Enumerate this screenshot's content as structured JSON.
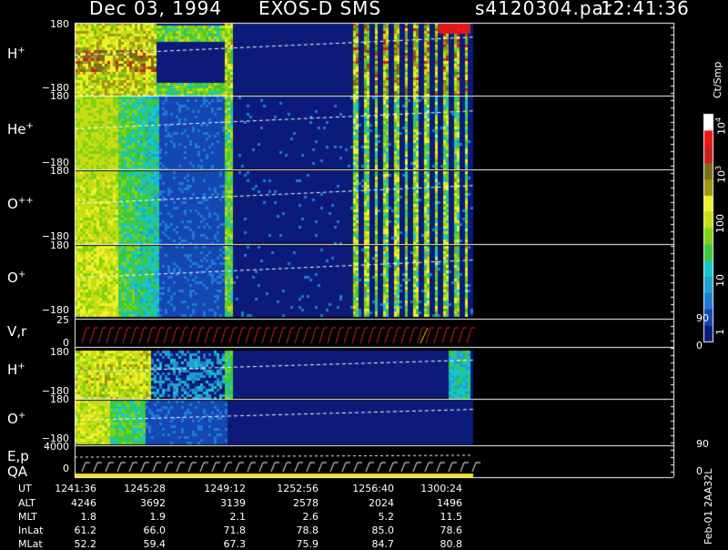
{
  "header": {
    "date": "Dec 03, 1994",
    "instrument": "EXOS-D SMS",
    "file": "s4120304.par",
    "time": "12:41:36"
  },
  "colorbar": {
    "unit": "Ct/Smp",
    "labels": [
      "1",
      "10",
      "100",
      "3",
      "4"
    ],
    "base": "10",
    "colors": [
      "#0c1a7a",
      "#1446b4",
      "#1e7ad2",
      "#1ea0d2",
      "#14c8c8",
      "#3cc83c",
      "#82d214",
      "#c8dc14",
      "#f0f028",
      "#a09614",
      "#786e14",
      "#c81e1e",
      "#f01414",
      "#ffffff"
    ]
  },
  "side_text": "Feb-01 2AA32L",
  "chart_data": {
    "type": "heatmap",
    "time_range": [
      "12:41:36",
      "13:01:42"
    ],
    "panels": [
      {
        "label": "H",
        "charge": "+",
        "ylim": [
          -180,
          180
        ],
        "ticks": [
          "180",
          "−180"
        ]
      },
      {
        "label": "He",
        "charge": "+",
        "ylim": [
          -180,
          180
        ],
        "ticks": [
          "180",
          "−180"
        ]
      },
      {
        "label": "O",
        "charge": "++",
        "ylim": [
          -180,
          180
        ],
        "ticks": [
          "180",
          "−180"
        ]
      },
      {
        "label": "O",
        "charge": "+",
        "ylim": [
          -180,
          180
        ],
        "ticks": [
          "180",
          "−180"
        ]
      },
      {
        "label": "V,r",
        "charge": "",
        "ylim": [
          0,
          25
        ],
        "ticks": [
          "25",
          "0"
        ],
        "right_ticks": [
          "90",
          "0"
        ]
      },
      {
        "label": "H",
        "charge": "+",
        "ylim": [
          -180,
          180
        ],
        "ticks": [
          "180",
          "−180"
        ]
      },
      {
        "label": "O",
        "charge": "+",
        "ylim": [
          -180,
          180
        ],
        "ticks": [
          "180",
          "−180"
        ]
      },
      {
        "label": "E,p",
        "label2": "QA",
        "charge": "",
        "ylim": [
          0,
          4000
        ],
        "ticks": [
          "4000",
          "0"
        ],
        "right_ticks": [
          "90",
          "0"
        ]
      }
    ],
    "axis_rows": [
      {
        "name": "UT",
        "values": [
          "1241:36",
          "1245:28",
          "1249:12",
          "1252:56",
          "1256:40",
          "1300:24"
        ]
      },
      {
        "name": "ALT",
        "values": [
          "4246",
          "3692",
          "3139",
          "2578",
          "2024",
          "1496"
        ]
      },
      {
        "name": "MLT",
        "values": [
          "1.8",
          "1.9",
          "2.1",
          "2.6",
          "5.2",
          "11.5"
        ]
      },
      {
        "name": "InLat",
        "values": [
          "61.2",
          "66.0",
          "71.8",
          "78.8",
          "85.0",
          "78.6"
        ]
      },
      {
        "name": "MLat",
        "values": [
          "52.2",
          "59.4",
          "67.3",
          "75.9",
          "84.7",
          "80.8"
        ]
      }
    ]
  }
}
